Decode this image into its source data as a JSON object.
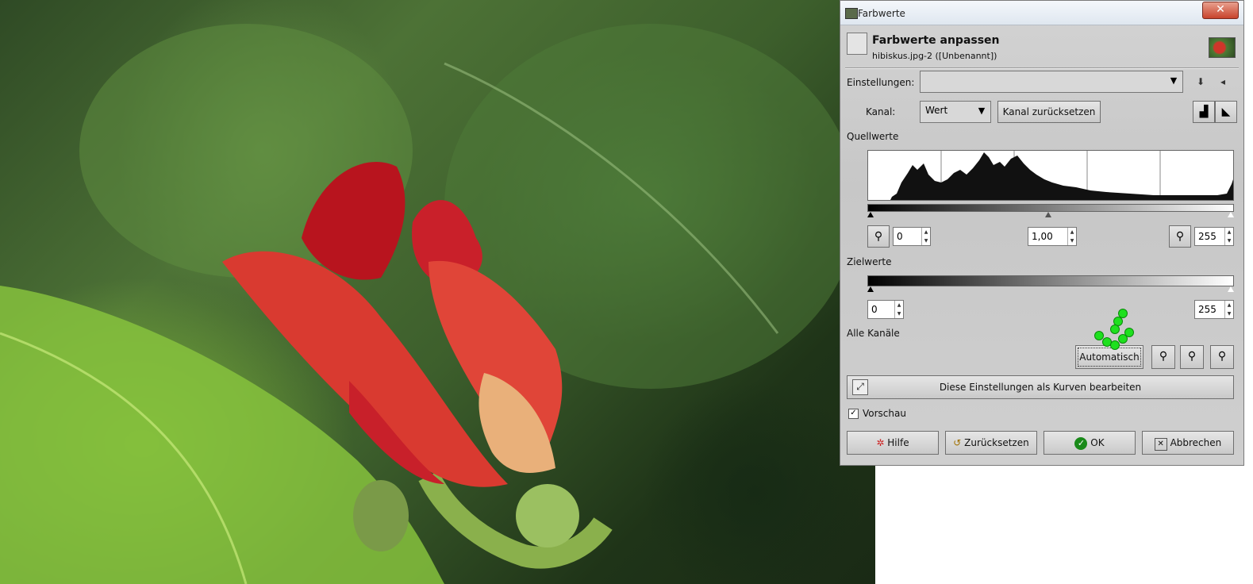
{
  "window": {
    "title": "Farbwerte",
    "close": "✕"
  },
  "header": {
    "title": "Farbwerte anpassen",
    "subtitle": "hibiskus.jpg-2 ([Unbenannt])"
  },
  "settings": {
    "label": "Einstellungen:",
    "value": ""
  },
  "channel": {
    "label": "Kanal:",
    "value": "Wert",
    "reset_label": "Kanal zurücksetzen"
  },
  "source": {
    "label": "Quellwerte",
    "low": "0",
    "gamma": "1,00",
    "high": "255"
  },
  "target": {
    "label": "Zielwerte",
    "low": "0",
    "high": "255"
  },
  "all_channels": {
    "label": "Alle Kanäle",
    "auto_label": "Automatisch"
  },
  "curves_label": "Diese Einstellungen als Kurven bearbeiten",
  "preview": {
    "label": "Vorschau",
    "checked": true
  },
  "buttons": {
    "help": "Hilfe",
    "reset": "Zurücksetzen",
    "ok": "OK",
    "cancel": "Abbrechen"
  },
  "icons": {
    "close": "close-icon",
    "eyedropper": "eyedropper-icon",
    "pointer_hand": "green-hand-pointer-icon"
  },
  "colors": {
    "accent_green": "#1ee01e",
    "close_red": "#c8432c"
  }
}
